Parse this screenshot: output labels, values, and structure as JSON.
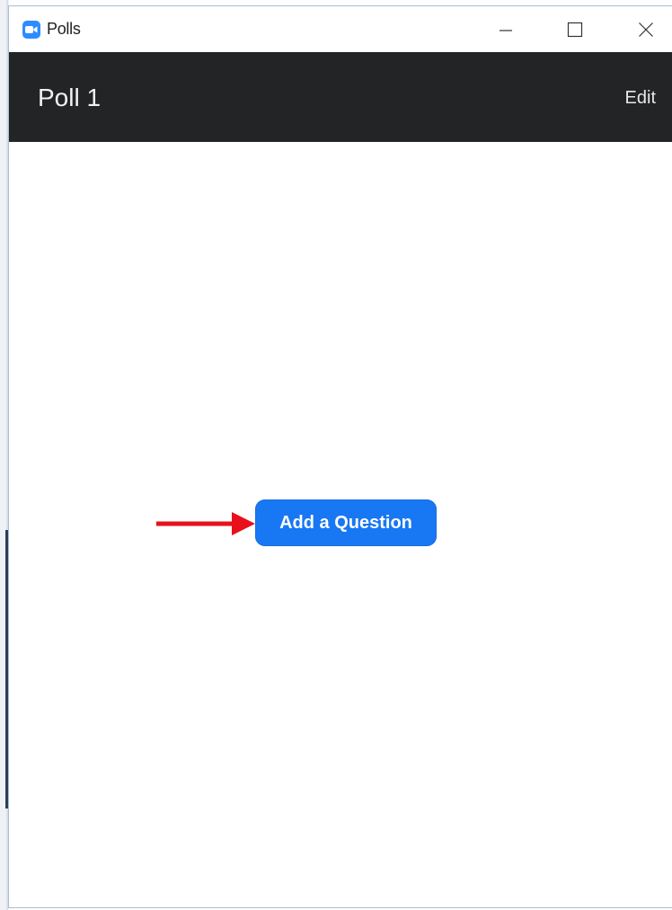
{
  "window": {
    "title": "Polls",
    "icon": "zoom-app-icon",
    "controls": [
      "minimize-icon",
      "maximize-icon",
      "close-icon"
    ]
  },
  "header": {
    "title": "Poll 1",
    "edit_label": "Edit"
  },
  "main": {
    "add_question_label": "Add a Question",
    "annotation": "red-arrow-icon"
  },
  "colors": {
    "header_bg": "#232426",
    "button_bg": "#1877f2",
    "arrow": "#e8101a",
    "app_icon": "#2d8cff"
  }
}
